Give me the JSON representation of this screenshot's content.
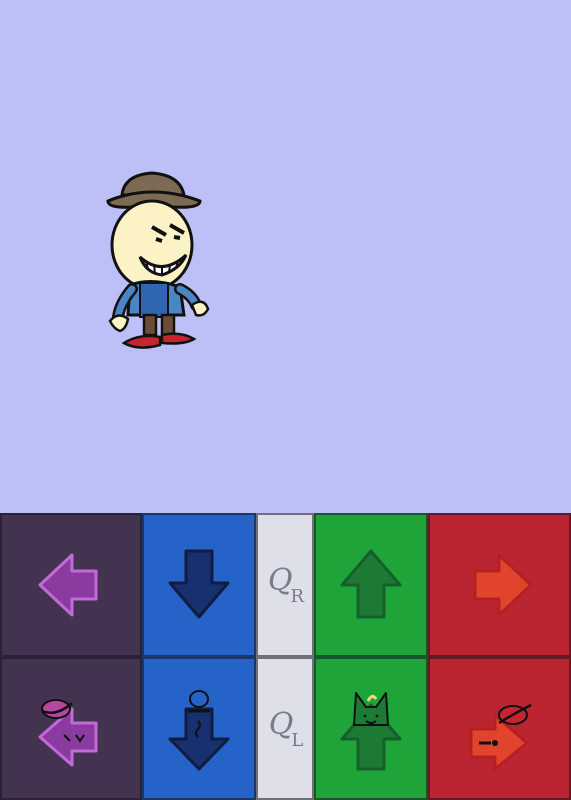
{
  "scene": {
    "background": "#bcc0f6",
    "character": "cartoon-boy-with-brown-hat"
  },
  "controls": {
    "top_row": [
      {
        "direction": "left",
        "icon": "left-arrow-icon",
        "color": "#8b3aa0"
      },
      {
        "direction": "down",
        "icon": "down-arrow-icon",
        "color": "#17306f"
      },
      {
        "label_main": "Q",
        "label_sub": "R"
      },
      {
        "direction": "up",
        "icon": "up-arrow-icon",
        "color": "#1c7a34"
      },
      {
        "direction": "right",
        "icon": "right-arrow-icon",
        "color": "#e2432c"
      }
    ],
    "bottom_row": [
      {
        "direction": "left",
        "icon": "left-arrow-with-hat-icon",
        "color": "#8b3aa0"
      },
      {
        "direction": "down",
        "icon": "down-arrow-with-figure-icon",
        "color": "#17306f"
      },
      {
        "label_main": "Q",
        "label_sub": "L"
      },
      {
        "direction": "up",
        "icon": "up-arrow-with-cat-icon",
        "color": "#1c7a34"
      },
      {
        "direction": "right",
        "icon": "right-arrow-with-hat-icon",
        "color": "#e2432c"
      }
    ],
    "column_colors": [
      "#433351",
      "#2563c8",
      "#dedfe9",
      "#1fa43a",
      "#bb2431"
    ]
  }
}
